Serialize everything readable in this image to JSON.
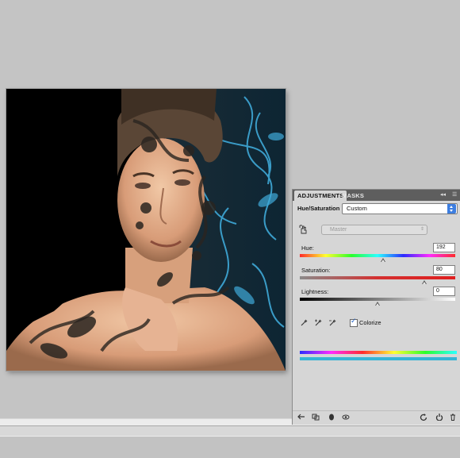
{
  "panel": {
    "tabs": [
      "ADJUSTMENTS",
      "MASKS"
    ],
    "title": "Hue/Saturation",
    "preset": "Custom",
    "channel": "Master",
    "hue": {
      "label": "Hue:",
      "value": "192",
      "position": 0.555
    },
    "saturation": {
      "label": "Saturation:",
      "value": "80",
      "position": 0.8
    },
    "lightness": {
      "label": "Lightness:",
      "value": "0",
      "position": 0.5
    },
    "colorize": {
      "label": "Colorize",
      "checked": true
    }
  },
  "icons": {
    "hand": "targeted-adjustment-icon",
    "eyedroppers": [
      "eyedropper-icon",
      "eyedropper-add-icon",
      "eyedropper-subtract-icon"
    ],
    "footer": [
      "return-icon",
      "clip-icon",
      "visibility-icon",
      "view-previous-icon",
      "reset-icon",
      "delete-icon"
    ]
  },
  "colors": {
    "accent": "#3d7ee0",
    "tint": "#3a9bc8",
    "panel_bg": "#d6d6d6",
    "tab_bar": "#5e5e5e"
  }
}
